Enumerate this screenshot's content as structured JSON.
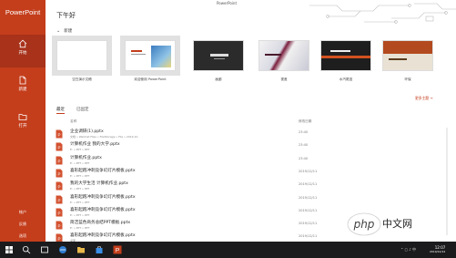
{
  "app": {
    "brand": "PowerPoint",
    "window_title": "PowerPoint"
  },
  "greeting": "下午好",
  "sidebar": {
    "items": [
      {
        "label": "开始",
        "icon": "home-icon",
        "active": true
      },
      {
        "label": "新建",
        "icon": "new-document-icon",
        "active": false
      },
      {
        "label": "打开",
        "icon": "open-folder-icon",
        "active": false
      }
    ],
    "bottom": [
      "帐户",
      "反馈",
      "选项"
    ]
  },
  "new_section": {
    "heading": "新建",
    "templates": [
      {
        "caption": "空白演示文稿"
      },
      {
        "caption": "欢迎使用 PowerPoint"
      },
      {
        "caption": "画廊"
      },
      {
        "caption": "视差"
      },
      {
        "caption": "水汽尾迹"
      },
      {
        "caption": "环保"
      }
    ],
    "more_link": "更多主题 →"
  },
  "tabs": {
    "recent": "最近",
    "pinned": "已固定"
  },
  "columns": {
    "name": "名称",
    "date": "修改日期"
  },
  "files": [
    {
      "name": "企业调研(1).pptx",
      "path": "文档 » WeChat Files » FileStorage » File » 2019-10",
      "date": "23:40"
    },
    {
      "name": "计算机作业 我的大学.pptx",
      "path": "E: » PPT » PPT",
      "date": "23:40"
    },
    {
      "name": "计算机作业.pptx",
      "path": "E: » PPT » PPT",
      "date": "23:40"
    },
    {
      "name": "喜形起跑冲刺竞争幻灯片模板.pptx",
      "path": "E: » PPT » PPT",
      "date": "2019/12/11"
    },
    {
      "name": "我的大学生活 计算机作业.pptx",
      "path": "E: » PPT » PPT",
      "date": "2019/12/11"
    },
    {
      "name": "喜形起跑冲刺竞争幻灯片模板.pptx",
      "path": "E: » PPT » PPT",
      "date": "2019/12/11"
    },
    {
      "name": "喜形起跑冲刺竞争幻灯片模板.pptx",
      "path": "E: » PPT » PPT",
      "date": "2019/12/11"
    },
    {
      "name": "简洁蓝色商务总结PPT模板.pptx",
      "path": "E: » PPT » PPT",
      "date": "2019/12/11"
    },
    {
      "name": "喜形起跑冲刺竞争幻灯片模板.pptx",
      "path": "桌面",
      "date": "2019/12/11"
    }
  ],
  "watermark": {
    "brand": "php",
    "subtitle": "中文网"
  },
  "taskbar": {
    "time": "12:07",
    "date": "2019/12/12"
  },
  "colors": {
    "accent": "#c43e1c",
    "taskbar": "#1b1b1d"
  }
}
